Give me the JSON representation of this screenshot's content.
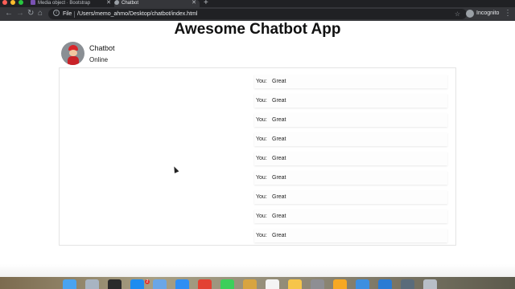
{
  "browser": {
    "tabs": [
      {
        "label": "Media object · Bootstrap",
        "favicon": "bootstrap-icon",
        "favicon_color": "#7952b3",
        "active": false
      },
      {
        "label": "Chatbot",
        "favicon": "globe-icon",
        "favicon_color": "#9aa0a6",
        "active": true
      }
    ],
    "new_tab_icon": "+",
    "url_scheme_label": "File",
    "url": "/Users/memo_ahmo/Desktop/chatbot/index.html",
    "incognito_label": "Incognito"
  },
  "page": {
    "title": "Awesome Chatbot App",
    "bot": {
      "name": "Chatbot",
      "status": "Online"
    },
    "messages": [
      {
        "sender": "You:",
        "text": "Great"
      },
      {
        "sender": "You:",
        "text": "Great"
      },
      {
        "sender": "You:",
        "text": "Great"
      },
      {
        "sender": "You:",
        "text": "Great"
      },
      {
        "sender": "You:",
        "text": "Great"
      },
      {
        "sender": "You:",
        "text": "Great"
      },
      {
        "sender": "You:",
        "text": "Great"
      },
      {
        "sender": "You:",
        "text": "Great"
      },
      {
        "sender": "You:",
        "text": "Great"
      }
    ]
  },
  "dock": {
    "apps": [
      {
        "name": "finder-icon",
        "color": "#4aa3f0"
      },
      {
        "name": "launchpad-icon",
        "color": "#a8b4c2"
      },
      {
        "name": "terminal-icon",
        "color": "#2b2b2b"
      },
      {
        "name": "app-store-icon",
        "color": "#1e8cf0"
      },
      {
        "name": "preview-icon",
        "color": "#6aa6e8"
      },
      {
        "name": "safari-icon",
        "color": "#2f8ef4"
      },
      {
        "name": "chrome-icon",
        "color": "#e34133"
      },
      {
        "name": "facetime-icon",
        "color": "#3ccf5a"
      },
      {
        "name": "notes-icon",
        "color": "#d8a440"
      },
      {
        "name": "music-icon",
        "color": "#f4f4f4"
      },
      {
        "name": "photos-icon",
        "color": "#f6c54a"
      },
      {
        "name": "system-preferences-icon",
        "color": "#8e8e93"
      },
      {
        "name": "sketch-icon",
        "color": "#f7a823"
      },
      {
        "name": "xcode-icon",
        "color": "#3d8fe0"
      },
      {
        "name": "vscode-icon",
        "color": "#2a7bd4"
      },
      {
        "name": "downloads-icon",
        "color": "#5a6b7a"
      },
      {
        "name": "trash-icon",
        "color": "#b8bec6"
      }
    ],
    "badge_count": "2"
  }
}
